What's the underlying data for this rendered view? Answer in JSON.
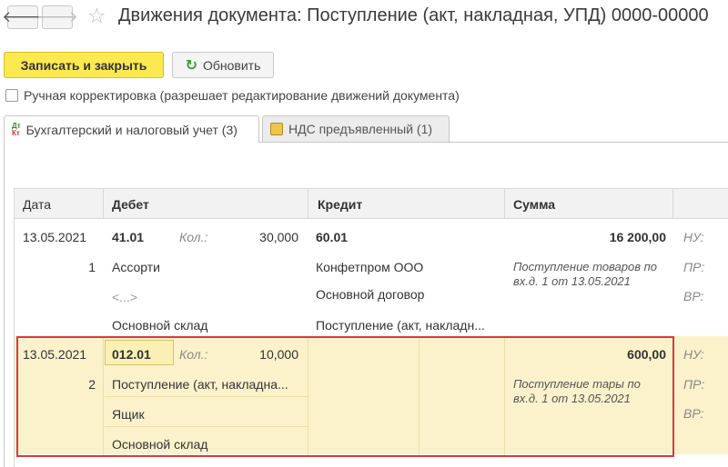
{
  "header": {
    "back_icon": "arrow-left-icon",
    "forward_icon": "arrow-right-icon",
    "favorite_icon": "star-icon",
    "title": "Движения документа: Поступление (акт, накладная, УПД) 0000-00000"
  },
  "toolbar": {
    "save_close_label": "Записать и закрыть",
    "refresh_label": "Обновить",
    "refresh_icon": "refresh-icon"
  },
  "manual_correction": {
    "label": "Ручная корректировка (разрешает редактирование движений документа)",
    "checked": false
  },
  "tabs": [
    {
      "label": "Бухгалтерский и налоговый учет (3)",
      "icon": "dt-kt-icon",
      "active": true
    },
    {
      "label": "НДС предъявленный (1)",
      "icon": "vat-register-icon",
      "active": false
    }
  ],
  "icon_text": {
    "dt": "Дт",
    "kt": "Кт"
  },
  "table": {
    "columns": [
      "Дата",
      "Дебет",
      "Кредит",
      "Сумма"
    ],
    "rows": [
      {
        "date": "13.05.2021",
        "num": "1",
        "debit_account": "41.01",
        "qty_label": "Кол.:",
        "qty": "30,000",
        "debit_sub1": "Ассорти",
        "debit_sub2": "<...>",
        "debit_sub3": "Основной склад",
        "credit_account": "60.01",
        "credit_sub1": "Конфетпром ООО",
        "credit_sub2": "Основной договор",
        "credit_sub3": "Поступление (акт, накладн...",
        "amount": "16 200,00",
        "content": "Поступление товаров по вх.д. 1 от 13.05.2021",
        "nu": "НУ:",
        "pr": "ПР:",
        "vr": "ВР:"
      },
      {
        "date": "13.05.2021",
        "num": "2",
        "debit_account": "012.01",
        "qty_label": "Кол.:",
        "qty": "10,000",
        "debit_sub1": "Поступление (акт, накладна...",
        "debit_sub2": "Ящик",
        "debit_sub3": "Основной склад",
        "amount": "600,00",
        "content": "Поступление тары по вх.д. 1 от 13.05.2021",
        "nu": "НУ:",
        "pr": "ПР:",
        "vr": "ВР:"
      }
    ]
  },
  "colors": {
    "primary_button": "#fbe94f",
    "highlight_row": "#fbf2cc",
    "selection_border": "#d83a3a"
  }
}
